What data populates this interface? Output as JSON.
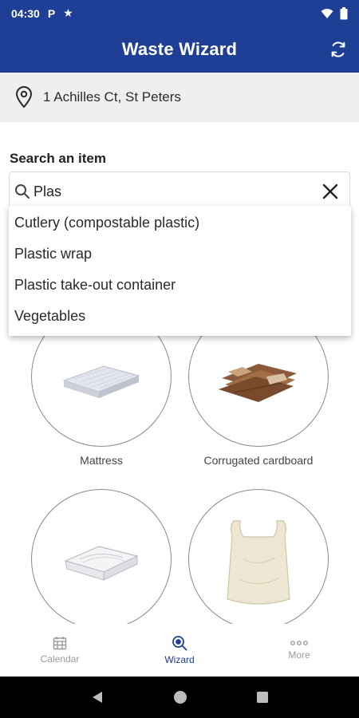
{
  "status_bar": {
    "time": "04:30",
    "left_icons": [
      "parking-icon",
      "star-icon"
    ],
    "right_icons": [
      "wifi-icon",
      "battery-icon"
    ]
  },
  "app_bar": {
    "title": "Waste Wizard",
    "background": "#1f3f96",
    "action_icon": "refresh-icon"
  },
  "address": {
    "icon": "location-pin-icon",
    "text": "1 Achilles Ct, St Peters"
  },
  "search": {
    "label": "Search an item",
    "value": "Plas",
    "icon": "search-icon",
    "clear_icon": "close-icon"
  },
  "dropdown": {
    "items": [
      "Cutlery (compostable plastic)",
      "Plastic wrap",
      "Plastic take-out container",
      "Vegetables"
    ]
  },
  "items": [
    {
      "label": "Mattress",
      "image": "mattress-image"
    },
    {
      "label": "Corrugated cardboard",
      "image": "cardboard-image"
    },
    {
      "label": "",
      "image": "takeout-container-image"
    },
    {
      "label": "",
      "image": "plastic-bag-image"
    }
  ],
  "bottom_nav": {
    "items": [
      {
        "label": "Calendar",
        "icon": "calendar-icon",
        "active": false
      },
      {
        "label": "Wizard",
        "icon": "wizard-search-icon",
        "active": true
      },
      {
        "label": "More",
        "icon": "more-icon",
        "active": false
      }
    ],
    "active_color": "#1f3f96",
    "inactive_color": "#9a9a9a"
  },
  "system_nav": {
    "icons": [
      "back-icon",
      "home-icon",
      "recents-icon"
    ]
  }
}
